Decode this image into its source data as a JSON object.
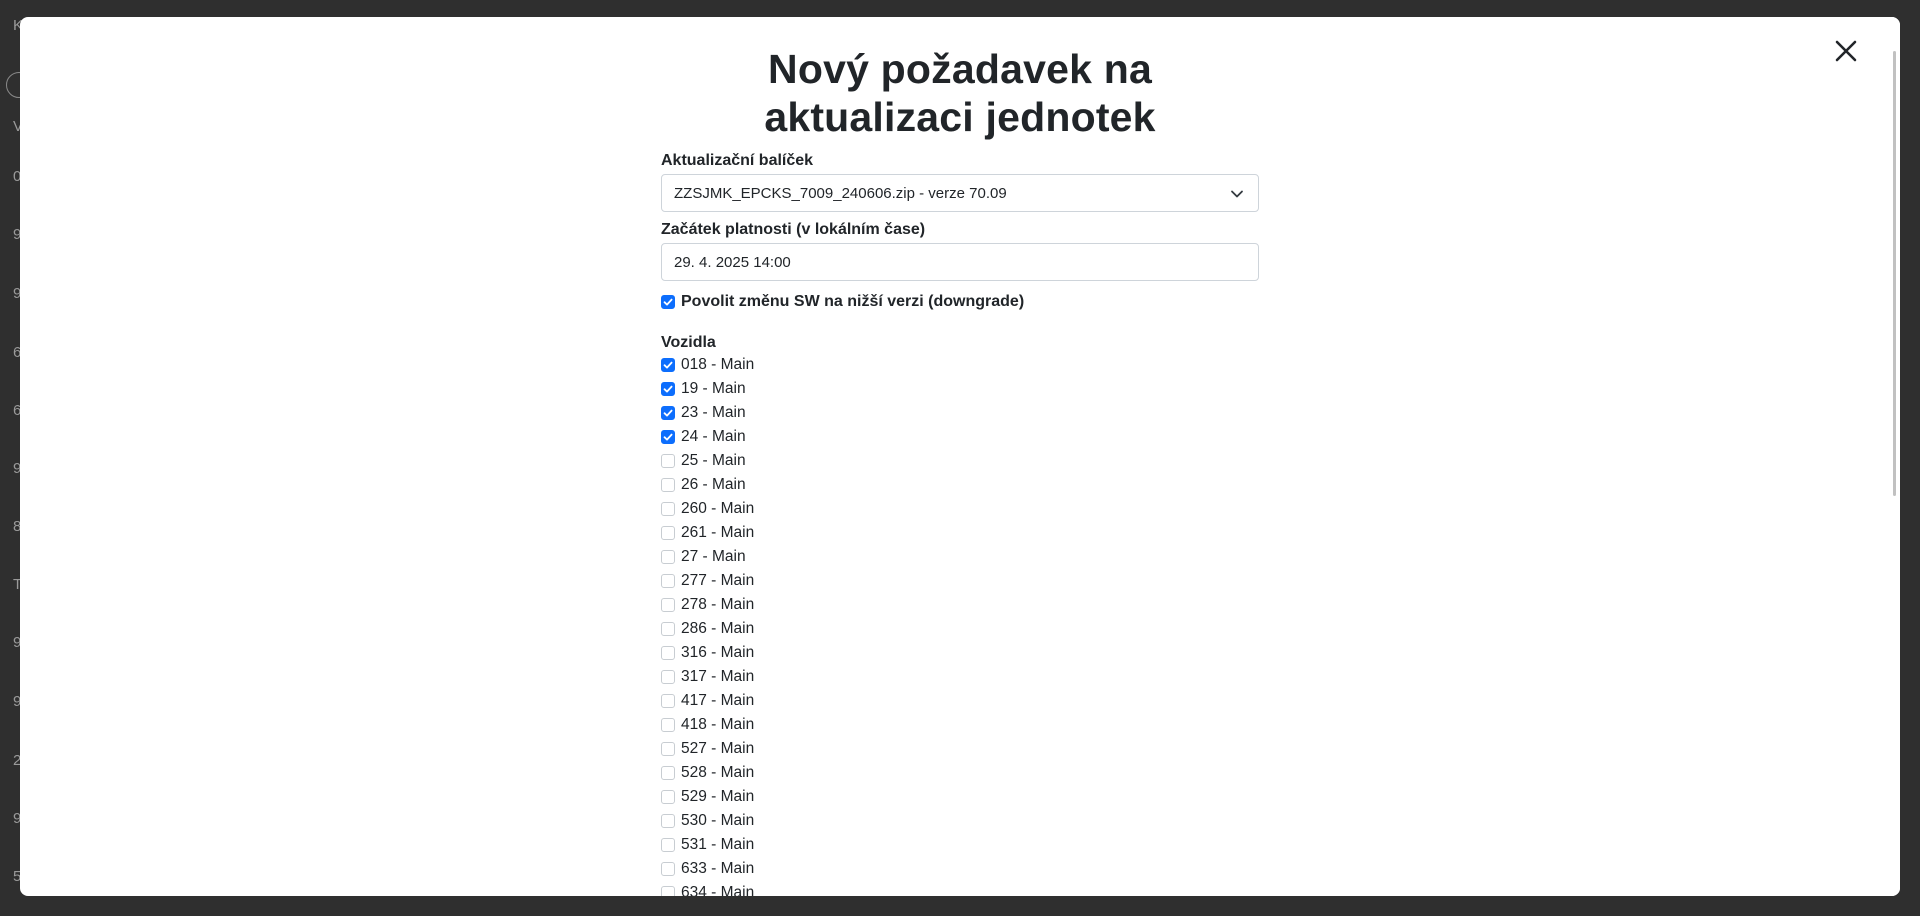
{
  "background": {
    "row_letters": [
      "K",
      "V",
      "0",
      "9",
      "9",
      "6",
      "6",
      "9",
      "8",
      "T",
      "9",
      "9",
      "2",
      "9",
      "5"
    ]
  },
  "modal": {
    "title": "Nový požadavek na aktualizaci jednotek",
    "package": {
      "label": "Aktualizační balíček",
      "selected": "ZZSJMK_EPCKS_7009_240606.zip - verze 70.09"
    },
    "validity": {
      "label": "Začátek platnosti (v lokálním čase)",
      "value": "29. 4. 2025 14:00"
    },
    "downgrade": {
      "label": "Povolit změnu SW na nižší verzi (downgrade)",
      "checked": true
    },
    "vehicles": {
      "label": "Vozidla",
      "items": [
        {
          "label": "018 - Main",
          "checked": true
        },
        {
          "label": "19 - Main",
          "checked": true
        },
        {
          "label": "23 - Main",
          "checked": true
        },
        {
          "label": "24 - Main",
          "checked": true
        },
        {
          "label": "25 - Main",
          "checked": false
        },
        {
          "label": "26 - Main",
          "checked": false
        },
        {
          "label": "260 - Main",
          "checked": false
        },
        {
          "label": "261 - Main",
          "checked": false
        },
        {
          "label": "27 - Main",
          "checked": false
        },
        {
          "label": "277 - Main",
          "checked": false
        },
        {
          "label": "278 - Main",
          "checked": false
        },
        {
          "label": "286 - Main",
          "checked": false
        },
        {
          "label": "316 - Main",
          "checked": false
        },
        {
          "label": "317 - Main",
          "checked": false
        },
        {
          "label": "417 - Main",
          "checked": false
        },
        {
          "label": "418 - Main",
          "checked": false
        },
        {
          "label": "527 - Main",
          "checked": false
        },
        {
          "label": "528 - Main",
          "checked": false
        },
        {
          "label": "529 - Main",
          "checked": false
        },
        {
          "label": "530 - Main",
          "checked": false
        },
        {
          "label": "531 - Main",
          "checked": false
        },
        {
          "label": "633 - Main",
          "checked": false
        },
        {
          "label": "634 - Main",
          "checked": false
        }
      ]
    }
  },
  "colors": {
    "accent": "#0d6efd",
    "overlay": "#2f2f2f",
    "text": "#212529"
  },
  "icons": {
    "close": "close-icon",
    "dropdown": "chevron-down-icon",
    "check": "check-icon"
  }
}
